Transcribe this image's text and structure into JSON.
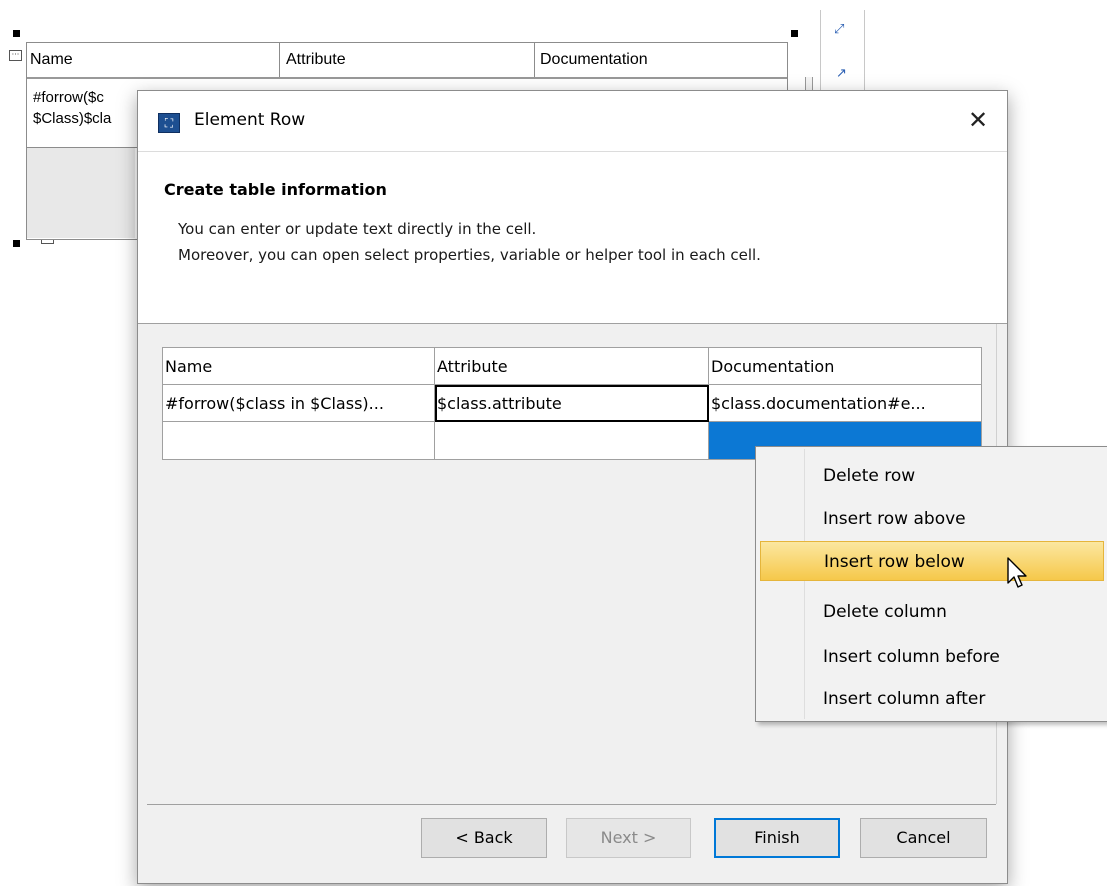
{
  "background_table": {
    "headers": [
      "Name",
      "Attribute",
      "Documentation"
    ],
    "row1_text": "#forrow($c\n$Class)$cla"
  },
  "dialog": {
    "title": "Element Row",
    "close_glyph": "✕",
    "banner": {
      "title": "Create table information",
      "line1": "You can enter or update text directly in the cell.",
      "line2": "Moreover, you can open select properties, variable or helper tool in each cell."
    },
    "table": {
      "headers": [
        "Name",
        "Attribute",
        "Documentation"
      ],
      "rows": [
        [
          "#forrow($class in $Class)...",
          "$class.attribute",
          "$class.documentation#e..."
        ],
        [
          "",
          "",
          ""
        ]
      ]
    },
    "buttons": {
      "back": "< Back",
      "next": "Next >",
      "finish": "Finish",
      "cancel": "Cancel"
    }
  },
  "context_menu": {
    "items": [
      "Delete row",
      "Insert row above",
      "Insert row below",
      "Delete column",
      "Insert column before",
      "Insert column after"
    ],
    "highlighted": "Insert row below"
  },
  "colors": {
    "selection_blue": "#0c78d4",
    "highlight": "#f6c84a",
    "default_button_border": "#0078d7"
  }
}
